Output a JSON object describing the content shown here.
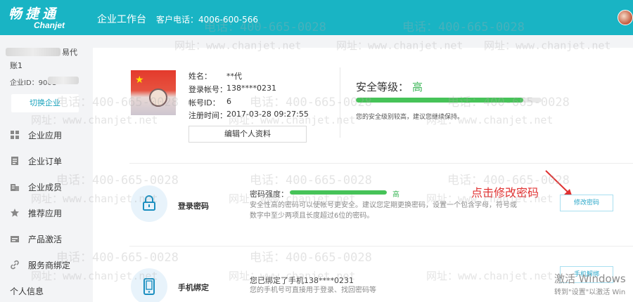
{
  "header": {
    "logo_cn": "畅捷通",
    "logo_en": "Chanjet",
    "workbench_title": "企业工作台",
    "hotline": "客户电话：4006-600-566"
  },
  "sidebar": {
    "company_suffix": "易代",
    "account_label": "账1",
    "enterprise_id_label": "企业ID：9001",
    "switch_label": "切换企业",
    "items": [
      {
        "label": "企业应用",
        "icon": "grid-icon"
      },
      {
        "label": "企业订单",
        "icon": "clipboard-icon"
      },
      {
        "label": "企业成员",
        "icon": "building-icon"
      },
      {
        "label": "推荐应用",
        "icon": "star-icon"
      },
      {
        "label": "产品激活",
        "icon": "card-icon"
      },
      {
        "label": "服务商绑定",
        "icon": "link-icon"
      }
    ],
    "personal_info": "个人信息"
  },
  "profile": {
    "name_label": "姓名：",
    "name_value": "**代",
    "account_label": "登录帐号：",
    "account_value": "138****0231",
    "id_label": "帐号ID：",
    "id_value": "6",
    "reg_label": "注册时间：",
    "reg_value": "2017-03-28 09:27:55",
    "edit_label": "编辑个人资料"
  },
  "security": {
    "level_label": "安全等级：",
    "level_value": "高",
    "level_fraction": 0.9,
    "tip": "您的安全级别较高，建议您继续保持。"
  },
  "password": {
    "title": "登录密码",
    "strength_label": "密码强度：",
    "strength_value": "高",
    "strength_fraction": 1.0,
    "desc_line1": "安全性高的密码可以使帐号更安全。建议您定期更换密码，设置一个包含字母，符号或",
    "desc_line2": "数字中至少两项且长度超过6位的密码。",
    "button_label": "修改密码",
    "annotation": "点击修改密码"
  },
  "phone": {
    "title": "手机绑定",
    "bound_text": "您已绑定了手机138****0231",
    "desc": "您的手机号可直接用于登录、找回密码等",
    "button_label": "手机解绑"
  },
  "watermark": {
    "phone": "电话：400-665-0028",
    "site": "网址：www.chanjet.net"
  },
  "windows": {
    "activate": "激活 Windows",
    "activate_sub": "转到\"设置\"以激活 Win"
  },
  "colors": {
    "header_bg": "#19b4c4",
    "green": "#46c358",
    "accent_blue": "#2aa7c9",
    "annotation_red": "#e03131"
  }
}
